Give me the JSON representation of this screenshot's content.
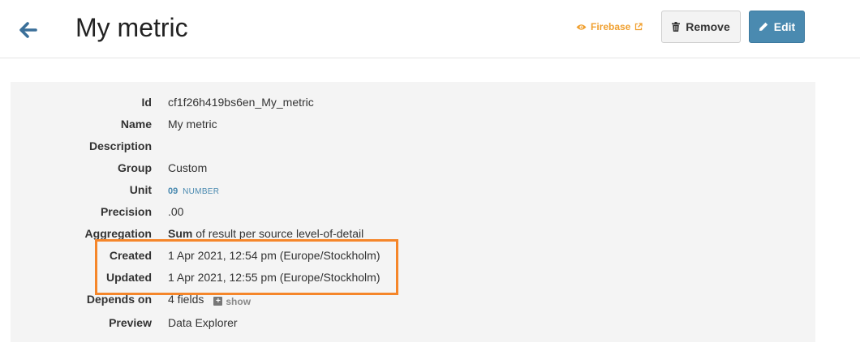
{
  "header": {
    "title": "My metric",
    "firebase_label": "Firebase",
    "remove_label": "Remove",
    "edit_label": "Edit"
  },
  "details": {
    "id": {
      "label": "Id",
      "value": "cf1f26h419bs6en_My_metric"
    },
    "name": {
      "label": "Name",
      "value": "My metric"
    },
    "description": {
      "label": "Description",
      "value": ""
    },
    "group": {
      "label": "Group",
      "value": "Custom"
    },
    "unit": {
      "label": "Unit",
      "code": "09",
      "type": "NUMBER"
    },
    "precision": {
      "label": "Precision",
      "value": ".00"
    },
    "aggregation": {
      "label": "Aggregation",
      "method": "Sum",
      "rest": " of result per source level-of-detail"
    },
    "created": {
      "label": "Created",
      "value": "1 Apr 2021, 12:54 pm (Europe/Stockholm)"
    },
    "updated": {
      "label": "Updated",
      "value": "1 Apr 2021, 12:55 pm (Europe/Stockholm)"
    },
    "depends_on": {
      "label": "Depends on",
      "value": "4 fields",
      "toggle": "show"
    },
    "preview": {
      "label": "Preview",
      "link": "Data Explorer"
    }
  },
  "colors": {
    "accent": "#4a8ab0",
    "firebase": "#f0a030",
    "highlight": "#f5862a",
    "panel": "#f4f4f4"
  },
  "icons": {
    "back": "arrow-left-icon",
    "eye": "eye-icon",
    "external": "external-link-icon",
    "trash": "trash-icon",
    "pencil": "pencil-icon",
    "plus": "plus-square-icon"
  }
}
